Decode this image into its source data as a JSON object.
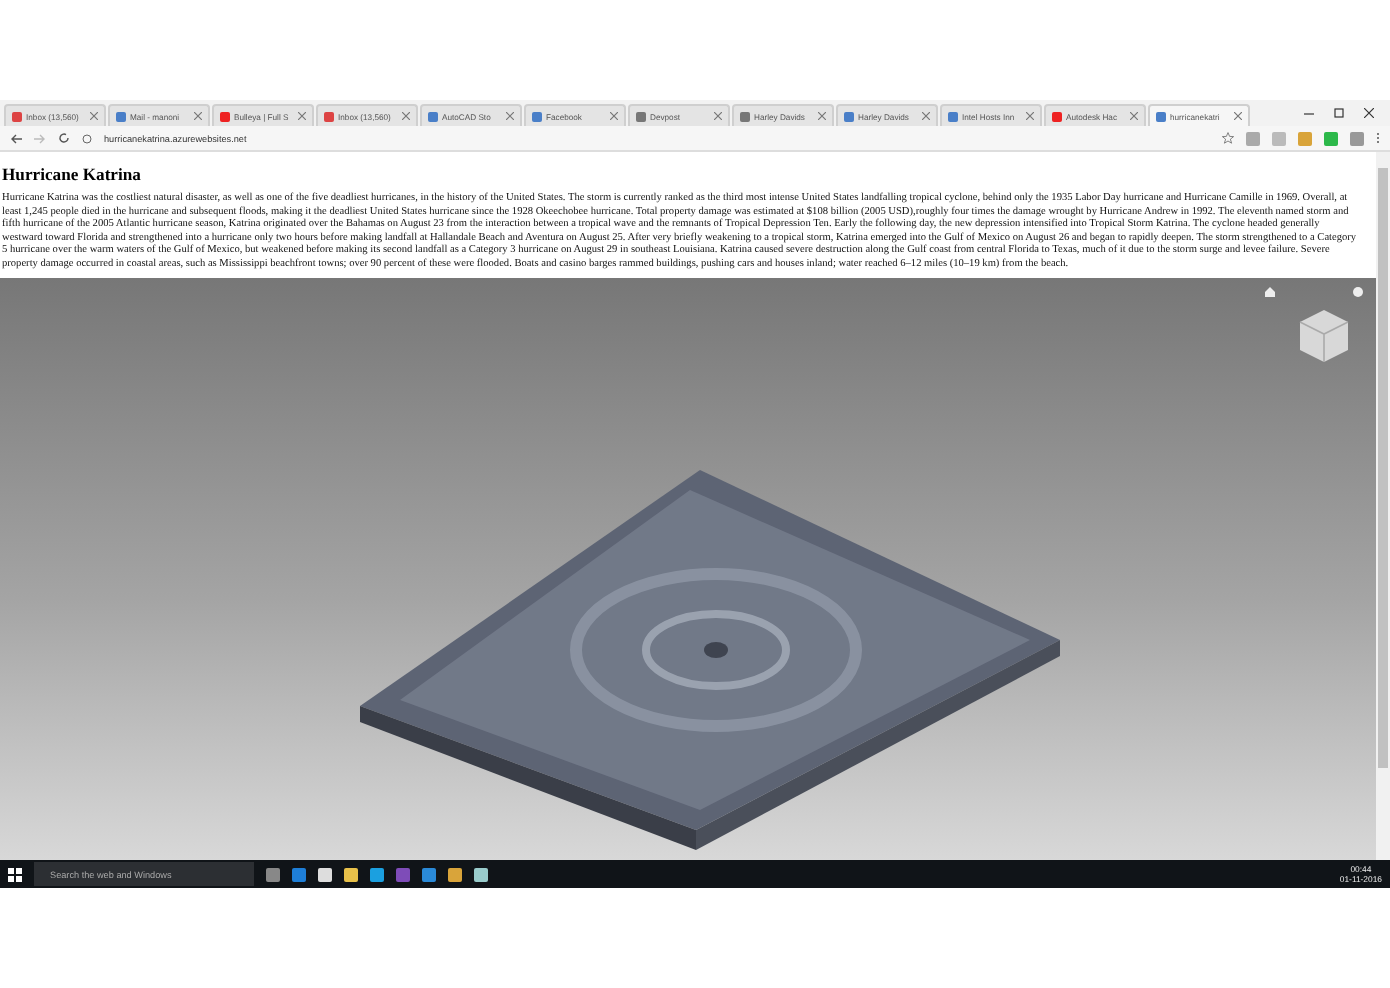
{
  "tabs": [
    {
      "label": "Inbox (13,560)",
      "selected": false,
      "kind": "mail"
    },
    {
      "label": "Mail - manoni",
      "selected": false,
      "kind": "doc"
    },
    {
      "label": "Bulleya | Full S",
      "selected": false,
      "kind": "video"
    },
    {
      "label": "Inbox (13,560)",
      "selected": false,
      "kind": "mail"
    },
    {
      "label": "AutoCAD Sto",
      "selected": false,
      "kind": "doc"
    },
    {
      "label": "Facebook",
      "selected": false,
      "kind": "doc"
    },
    {
      "label": "Devpost",
      "selected": false,
      "kind": "globe"
    },
    {
      "label": "Harley Davids",
      "selected": false,
      "kind": "globe"
    },
    {
      "label": "Harley Davids",
      "selected": false,
      "kind": "doc"
    },
    {
      "label": "Intel Hosts Inn",
      "selected": false,
      "kind": "doc"
    },
    {
      "label": "Autodesk Hac",
      "selected": false,
      "kind": "video"
    },
    {
      "label": "hurricanekatri",
      "selected": true,
      "kind": "doc"
    }
  ],
  "address": "hurricanekatrina.azurewebsites.net",
  "page": {
    "title": "Hurricane Katrina",
    "paragraph": "Hurricane Katrina was the costliest natural disaster, as well as one of the five deadliest hurricanes, in the history of the United States. The storm is currently ranked as the third most intense United States landfalling tropical cyclone, behind only the 1935 Labor Day hurricane and Hurricane Camille in 1969. Overall, at least 1,245 people died in the hurricane and subsequent floods, making it the deadliest United States hurricane since the 1928 Okeechobee hurricane. Total property damage was estimated at $108 billion (2005 USD),roughly four times the damage wrought by Hurricane Andrew in 1992. The eleventh named storm and fifth hurricane of the 2005 Atlantic hurricane season, Katrina originated over the Bahamas on August 23 from the interaction between a tropical wave and the remnants of Tropical Depression Ten. Early the following day, the new depression intensified into Tropical Storm Katrina. The cyclone headed generally westward toward Florida and strengthened into a hurricane only two hours before making landfall at Hallandale Beach and Aventura on August 25. After very briefly weakening to a tropical storm, Katrina emerged into the Gulf of Mexico on August 26 and began to rapidly deepen. The storm strengthened to a Category 5 hurricane over the warm waters of the Gulf of Mexico, but weakened before making its second landfall as a Category 3 hurricane on August 29 in southeast Louisiana. Katrina caused severe destruction along the Gulf coast from central Florida to Texas, much of it due to the storm surge and levee failure. Severe property damage occurred in coastal areas, such as Mississippi beachfront towns; over 90 percent of these were flooded. Boats and casino barges rammed buildings, pushing cars and houses inland; water reached 6–12 miles (10–19 km) from the beach."
  },
  "taskbar": {
    "search_placeholder": "Search the web and Windows",
    "time": "00:44",
    "date": "01-11-2016"
  }
}
